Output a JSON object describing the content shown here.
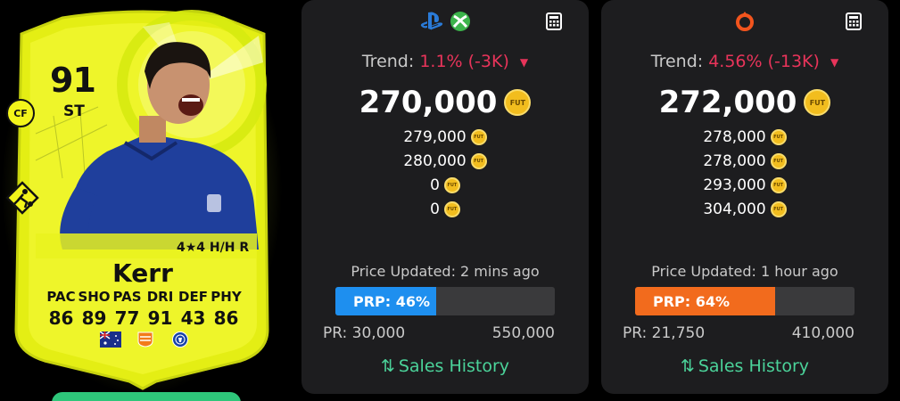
{
  "card": {
    "rating": "91",
    "position": "ST",
    "role_badge": "CF",
    "skills": "4★4 H/H R",
    "name": "Kerr",
    "stat_labels": [
      "PAC",
      "SHO",
      "PAS",
      "DRI",
      "DEF",
      "PHY"
    ],
    "stat_values": [
      "86",
      "89",
      "77",
      "91",
      "43",
      "86"
    ],
    "flags": [
      "australia-flag-icon",
      "league-badge-icon",
      "chelsea-badge-icon"
    ],
    "card_color": "#f3f51a"
  },
  "panels": {
    "console": {
      "platform_icons": [
        "playstation-icon",
        "xbox-icon"
      ],
      "trend_label": "Trend:",
      "trend_value": "1.1% (-3K)",
      "main_price": "270,000",
      "prices": [
        "279,000",
        "280,000",
        "0",
        "0"
      ],
      "updated": "Price Updated: 2 mins ago",
      "prp_label": "PRP: 46%",
      "prp_percent": 46,
      "prp_color": "#1e8fef",
      "pr_min": "PR: 30,000",
      "pr_max": "550,000",
      "sales_label": "Sales History"
    },
    "pc": {
      "platform_icons": [
        "origin-icon"
      ],
      "trend_label": "Trend:",
      "trend_value": "4.56% (-13K)",
      "main_price": "272,000",
      "prices": [
        "278,000",
        "278,000",
        "293,000",
        "304,000"
      ],
      "updated": "Price Updated: 1 hour ago",
      "prp_label": "PRP: 64%",
      "prp_percent": 64,
      "prp_color": "#f26b1d",
      "pr_min": "PR: 21,750",
      "pr_max": "410,000",
      "sales_label": "Sales History"
    }
  },
  "coin_label": "FUT",
  "colors": {
    "trend_down": "#e8345a",
    "sales_link": "#4bd39a",
    "panel_bg": "#1d1d1f",
    "coin": "#f2bd1e"
  }
}
